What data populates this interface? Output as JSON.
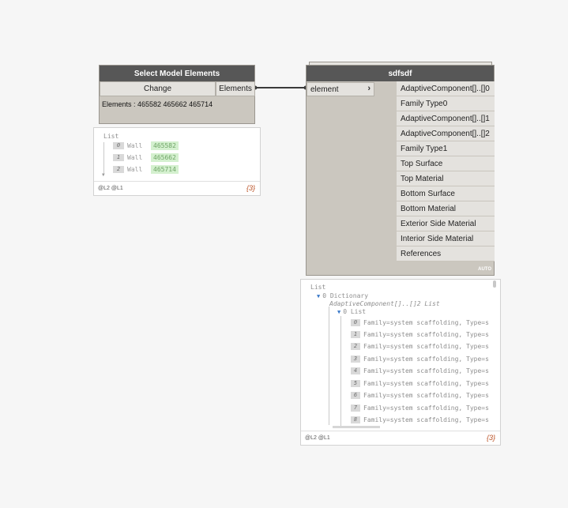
{
  "node_select": {
    "title": "Select Model Elements",
    "change_label": "Change",
    "output_label": "Elements",
    "elements_text": "Elements : 465582 465662 465714"
  },
  "preview1": {
    "title": "List",
    "items": [
      {
        "index": "0",
        "name": "Wall",
        "id": "465582"
      },
      {
        "index": "1",
        "name": "Wall",
        "id": "465662"
      },
      {
        "index": "2",
        "name": "Wall",
        "id": "465714"
      }
    ],
    "levels": "@L2 @L1",
    "count": "{3}"
  },
  "node_custom": {
    "title": "sdfsdf",
    "input_label": "element",
    "outputs": [
      "AdaptiveComponent[]..[]0",
      "Family Type0",
      "AdaptiveComponent[]..[]1",
      "AdaptiveComponent[]..[]2",
      "Family Type1",
      "Top Surface",
      "Top Material",
      "Bottom Surface",
      "Bottom Material",
      "Exterior Side Material",
      "Interior Side Material",
      "References"
    ],
    "lacing": "AUTO"
  },
  "preview2": {
    "title": "List",
    "dict_label": "0  Dictionary",
    "key_label": "AdaptiveComponent[]..[]2 List",
    "sub_label": "0 List",
    "items": [
      {
        "index": "0",
        "text": "Family=system scaffolding, Type=s"
      },
      {
        "index": "1",
        "text": "Family=system scaffolding, Type=s"
      },
      {
        "index": "2",
        "text": "Family=system scaffolding, Type=s"
      },
      {
        "index": "3",
        "text": "Family=system scaffolding, Type=s"
      },
      {
        "index": "4",
        "text": "Family=system scaffolding, Type=s"
      },
      {
        "index": "5",
        "text": "Family=system scaffolding, Type=s"
      },
      {
        "index": "6",
        "text": "Family=system scaffolding, Type=s"
      },
      {
        "index": "7",
        "text": "Family=system scaffolding, Type=s"
      },
      {
        "index": "8",
        "text": "Family=system scaffolding, Type=s"
      }
    ],
    "levels": "@L2 @L1",
    "count": "{3}"
  },
  "colors": {
    "node_body": "#cbc7bf",
    "node_header": "#575757",
    "port_bg": "#e4e2de",
    "green_value": "#d4f0cf",
    "count_color": "#b84b1d",
    "tree_arrow": "#3a79c9"
  }
}
